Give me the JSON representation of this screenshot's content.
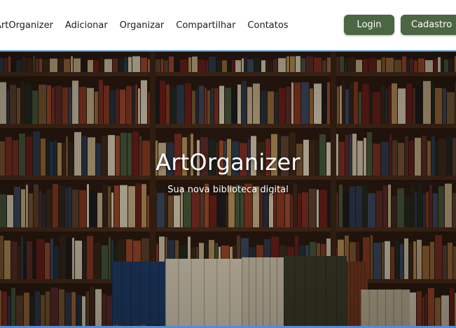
{
  "nav": {
    "brand": "ArtOrganizer",
    "links": [
      "Adicionar",
      "Organizar",
      "Compartilhar",
      "Contatos"
    ],
    "login_label": "Login",
    "signup_label": "Cadastro",
    "button_color": "#4a6741"
  },
  "hero": {
    "title": "ArtOrganizer",
    "subtitle": "Sua nova biblioteca digital",
    "image": "bookshelf-photo",
    "accent_border_color": "#4f8dd4"
  }
}
